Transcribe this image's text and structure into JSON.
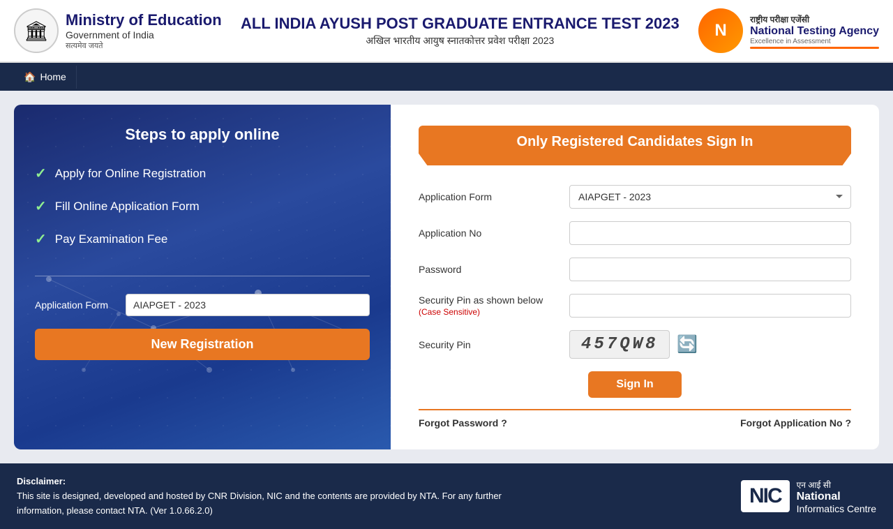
{
  "header": {
    "ministry_name": "Ministry of Education",
    "gov_name": "Government of India",
    "gov_hindi": "सत्यमेव जयते",
    "logo_emoji": "🏛",
    "exam_title": "ALL INDIA AYUSH POST GRADUATE ENTRANCE TEST 2023",
    "exam_hindi": "अखिल भारतीय आयुष स्नातकोत्तर प्रवेश परीक्षा 2023",
    "nta_hindi": "राष्ट्रीय परीक्षा एजेंसी",
    "nta_full": "National Testing Agency",
    "nta_tagline": "Excellence in Assessment"
  },
  "navbar": {
    "home_label": "Home"
  },
  "left_panel": {
    "title": "Steps to apply online",
    "steps": [
      "Apply for Online Registration",
      "Fill Online Application Form",
      "Pay Examination Fee"
    ],
    "application_form_label": "Application Form",
    "application_form_value": "AIAPGET - 2023",
    "new_registration_btn": "New Registration"
  },
  "right_panel": {
    "sign_in_title": "Only Registered Candidates Sign In",
    "fields": {
      "application_form_label": "Application Form",
      "application_form_value": "AIAPGET - 2023",
      "application_no_label": "Application No",
      "application_no_placeholder": "",
      "password_label": "Password",
      "password_placeholder": "",
      "security_pin_label": "Security Pin as shown below",
      "case_sensitive_note": "(Case Sensitive)",
      "security_pin_field_label": "Security Pin",
      "captcha_value": "457QW8"
    },
    "sign_in_btn": "Sign In",
    "forgot_password": "Forgot Password ?",
    "forgot_application_no": "Forgot Application No ?"
  },
  "footer": {
    "disclaimer_title": "Disclaimer:",
    "disclaimer_text": "This site is designed, developed and hosted by CNR Division, NIC and the contents are provided by NTA. For any further information, please contact NTA. (Ver 1.0.66.2.0)",
    "nic_label": "NIC",
    "nic_hindi": "एन आई सी",
    "nic_full": "National",
    "nic_centre": "Informatics Centre"
  }
}
